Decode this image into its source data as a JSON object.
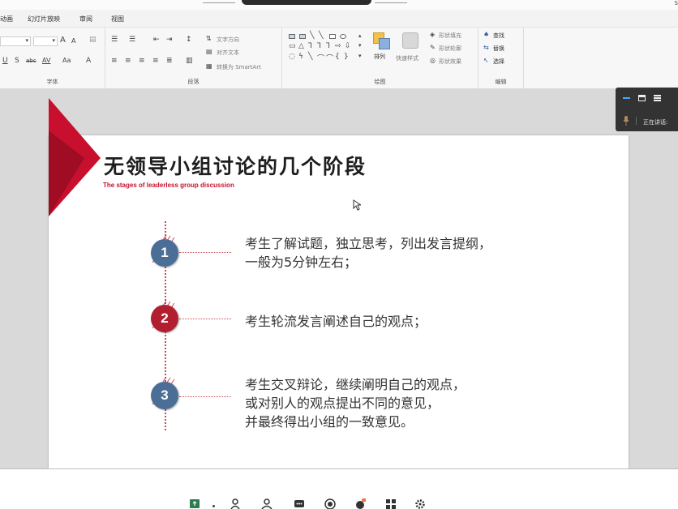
{
  "window": {
    "user_label": "S"
  },
  "menu": {
    "items": [
      "动画",
      "幻灯片放映",
      "审阅",
      "视图"
    ]
  },
  "ribbon": {
    "font_group": {
      "label": "字体",
      "grow_label": "A",
      "shrink_label": "A",
      "underline": "U",
      "strike": "S",
      "abc": "abc",
      "spacing": "AV",
      "case": "Aa",
      "font_color": "A"
    },
    "paragraph_group": {
      "label": "段落",
      "text_direction": "文字方向",
      "align_text": "对齐文本",
      "smartart": "转换为 SmartArt"
    },
    "drawing_group": {
      "label": "绘图",
      "arrange": "排列",
      "quick_styles": "快速样式",
      "shape_fill": "形状填充",
      "shape_outline": "形状轮廓",
      "shape_effects": "形状效果"
    },
    "editing_group": {
      "label": "编辑",
      "find": "查找",
      "replace": "替换",
      "select": "选择"
    }
  },
  "slide": {
    "title": "无领导小组讨论的几个阶段",
    "subtitle": "The stages of leaderless group discussion",
    "steps": [
      {
        "number": "1",
        "color": "#4a6e96",
        "text": "考生了解试题，独立思考，列出发言提纲，\n一般为5分钟左右；"
      },
      {
        "number": "2",
        "color": "#b01e2f",
        "text": "考生轮流发言阐述自己的观点；"
      },
      {
        "number": "3",
        "color": "#4a6e96",
        "text": "考生交叉辩论，继续阐明自己的观点，\n或对别人的观点提出不同的意见，\n并最终得出小组的一致意见。"
      }
    ],
    "accent_color": "#c8102e"
  },
  "float_panel": {
    "speaking_label": "正在讲话:"
  },
  "bottom_toolbar": {
    "icons": [
      "share-screen-icon",
      "participants-add-icon",
      "participants-icon",
      "chat-icon",
      "record-icon",
      "reactions-icon",
      "apps-icon",
      "settings-icon"
    ]
  }
}
